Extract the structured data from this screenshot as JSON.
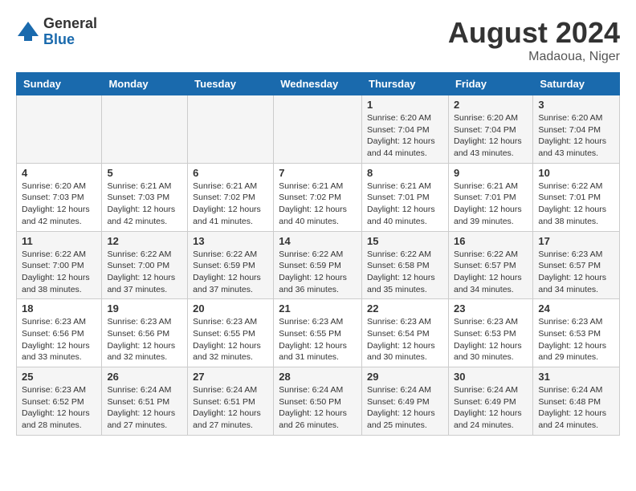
{
  "logo": {
    "general": "General",
    "blue": "Blue"
  },
  "title": {
    "month_year": "August 2024",
    "location": "Madaoua, Niger"
  },
  "weekdays": [
    "Sunday",
    "Monday",
    "Tuesday",
    "Wednesday",
    "Thursday",
    "Friday",
    "Saturday"
  ],
  "weeks": [
    [
      {
        "day": "",
        "info": ""
      },
      {
        "day": "",
        "info": ""
      },
      {
        "day": "",
        "info": ""
      },
      {
        "day": "",
        "info": ""
      },
      {
        "day": "1",
        "info": "Sunrise: 6:20 AM\nSunset: 7:04 PM\nDaylight: 12 hours\nand 44 minutes."
      },
      {
        "day": "2",
        "info": "Sunrise: 6:20 AM\nSunset: 7:04 PM\nDaylight: 12 hours\nand 43 minutes."
      },
      {
        "day": "3",
        "info": "Sunrise: 6:20 AM\nSunset: 7:04 PM\nDaylight: 12 hours\nand 43 minutes."
      }
    ],
    [
      {
        "day": "4",
        "info": "Sunrise: 6:20 AM\nSunset: 7:03 PM\nDaylight: 12 hours\nand 42 minutes."
      },
      {
        "day": "5",
        "info": "Sunrise: 6:21 AM\nSunset: 7:03 PM\nDaylight: 12 hours\nand 42 minutes."
      },
      {
        "day": "6",
        "info": "Sunrise: 6:21 AM\nSunset: 7:02 PM\nDaylight: 12 hours\nand 41 minutes."
      },
      {
        "day": "7",
        "info": "Sunrise: 6:21 AM\nSunset: 7:02 PM\nDaylight: 12 hours\nand 40 minutes."
      },
      {
        "day": "8",
        "info": "Sunrise: 6:21 AM\nSunset: 7:01 PM\nDaylight: 12 hours\nand 40 minutes."
      },
      {
        "day": "9",
        "info": "Sunrise: 6:21 AM\nSunset: 7:01 PM\nDaylight: 12 hours\nand 39 minutes."
      },
      {
        "day": "10",
        "info": "Sunrise: 6:22 AM\nSunset: 7:01 PM\nDaylight: 12 hours\nand 38 minutes."
      }
    ],
    [
      {
        "day": "11",
        "info": "Sunrise: 6:22 AM\nSunset: 7:00 PM\nDaylight: 12 hours\nand 38 minutes."
      },
      {
        "day": "12",
        "info": "Sunrise: 6:22 AM\nSunset: 7:00 PM\nDaylight: 12 hours\nand 37 minutes."
      },
      {
        "day": "13",
        "info": "Sunrise: 6:22 AM\nSunset: 6:59 PM\nDaylight: 12 hours\nand 37 minutes."
      },
      {
        "day": "14",
        "info": "Sunrise: 6:22 AM\nSunset: 6:59 PM\nDaylight: 12 hours\nand 36 minutes."
      },
      {
        "day": "15",
        "info": "Sunrise: 6:22 AM\nSunset: 6:58 PM\nDaylight: 12 hours\nand 35 minutes."
      },
      {
        "day": "16",
        "info": "Sunrise: 6:22 AM\nSunset: 6:57 PM\nDaylight: 12 hours\nand 34 minutes."
      },
      {
        "day": "17",
        "info": "Sunrise: 6:23 AM\nSunset: 6:57 PM\nDaylight: 12 hours\nand 34 minutes."
      }
    ],
    [
      {
        "day": "18",
        "info": "Sunrise: 6:23 AM\nSunset: 6:56 PM\nDaylight: 12 hours\nand 33 minutes."
      },
      {
        "day": "19",
        "info": "Sunrise: 6:23 AM\nSunset: 6:56 PM\nDaylight: 12 hours\nand 32 minutes."
      },
      {
        "day": "20",
        "info": "Sunrise: 6:23 AM\nSunset: 6:55 PM\nDaylight: 12 hours\nand 32 minutes."
      },
      {
        "day": "21",
        "info": "Sunrise: 6:23 AM\nSunset: 6:55 PM\nDaylight: 12 hours\nand 31 minutes."
      },
      {
        "day": "22",
        "info": "Sunrise: 6:23 AM\nSunset: 6:54 PM\nDaylight: 12 hours\nand 30 minutes."
      },
      {
        "day": "23",
        "info": "Sunrise: 6:23 AM\nSunset: 6:53 PM\nDaylight: 12 hours\nand 30 minutes."
      },
      {
        "day": "24",
        "info": "Sunrise: 6:23 AM\nSunset: 6:53 PM\nDaylight: 12 hours\nand 29 minutes."
      }
    ],
    [
      {
        "day": "25",
        "info": "Sunrise: 6:23 AM\nSunset: 6:52 PM\nDaylight: 12 hours\nand 28 minutes."
      },
      {
        "day": "26",
        "info": "Sunrise: 6:24 AM\nSunset: 6:51 PM\nDaylight: 12 hours\nand 27 minutes."
      },
      {
        "day": "27",
        "info": "Sunrise: 6:24 AM\nSunset: 6:51 PM\nDaylight: 12 hours\nand 27 minutes."
      },
      {
        "day": "28",
        "info": "Sunrise: 6:24 AM\nSunset: 6:50 PM\nDaylight: 12 hours\nand 26 minutes."
      },
      {
        "day": "29",
        "info": "Sunrise: 6:24 AM\nSunset: 6:49 PM\nDaylight: 12 hours\nand 25 minutes."
      },
      {
        "day": "30",
        "info": "Sunrise: 6:24 AM\nSunset: 6:49 PM\nDaylight: 12 hours\nand 24 minutes."
      },
      {
        "day": "31",
        "info": "Sunrise: 6:24 AM\nSunset: 6:48 PM\nDaylight: 12 hours\nand 24 minutes."
      }
    ]
  ]
}
